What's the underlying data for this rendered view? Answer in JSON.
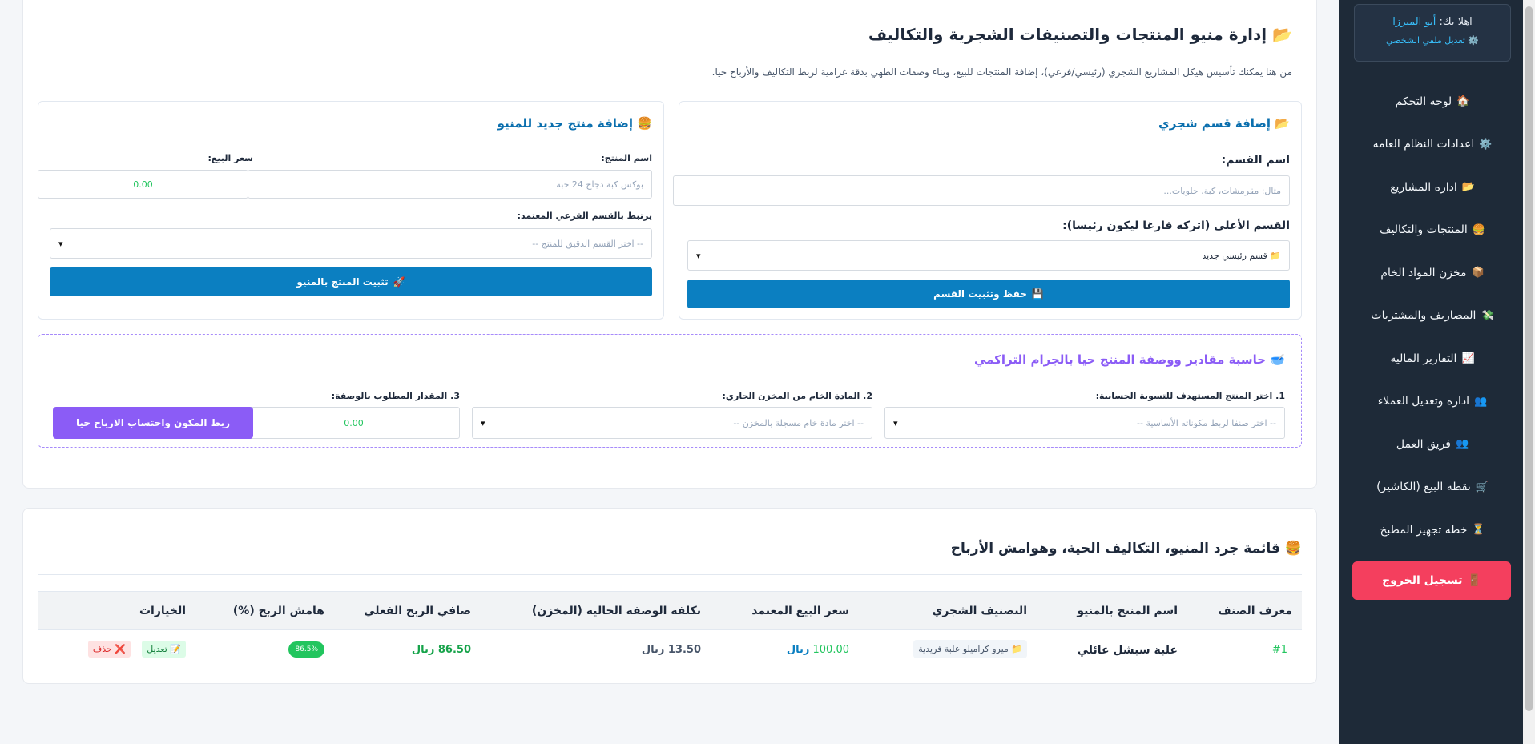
{
  "sidebar": {
    "greeting": "اهلا بك:",
    "user_name": "أبو الميرزا",
    "edit_profile": "تعديل ملفي الشخصي",
    "items": [
      {
        "icon": "🏠",
        "label": "لوحه التحكم"
      },
      {
        "icon": "⚙️",
        "label": "اعدادات النظام العامه"
      },
      {
        "icon": "📂",
        "label": "اداره المشاريع"
      },
      {
        "icon": "🍔",
        "label": "المنتجات والتكاليف"
      },
      {
        "icon": "📦",
        "label": "مخزن المواد الخام"
      },
      {
        "icon": "💸",
        "label": "المصاريف والمشتريات"
      },
      {
        "icon": "📈",
        "label": "التقارير الماليه"
      },
      {
        "icon": "👥",
        "label": "اداره وتعديل العملاء"
      },
      {
        "icon": "👥",
        "label": "فريق العمل"
      },
      {
        "icon": "🛒",
        "label": "نقطه البيع (الكاشير)"
      },
      {
        "icon": "⏳",
        "label": "خطه تجهيز المطبخ"
      }
    ],
    "logout": "تسجيل الخروج"
  },
  "header": {
    "title": "إدارة منيو المنتجات والتصنيفات الشجرية والتكاليف",
    "description": "من هنا يمكنك تأسيس هيكل المشاريع الشجري (رئيسي/فرعي)، إضافة المنتجات للبيع، وبناء وصفات الطهي بدقة غرامية لربط التكاليف والأرباح حيا."
  },
  "category_form": {
    "title": "إضافة قسم شجري",
    "name_label": "اسم القسم:",
    "name_placeholder": "مثال: مقرمشات، كبة، حلويات...",
    "parent_label": "القسم الأعلى (اتركه فارغا ليكون رئيسا):",
    "parent_value": "📁 قسم رئيسي جديد",
    "submit": "حفظ وتثبيت القسم"
  },
  "product_form": {
    "title": "إضافة منتج جديد للمنيو",
    "name_label": "اسم المنتج:",
    "name_placeholder": "بوكس كبة دجاج 24 حبة",
    "price_label": "سعر البيع:",
    "price_placeholder": "0.00",
    "subcat_label": "يرتبط بالقسم الفرعي المعتمد:",
    "subcat_value": "-- اختر القسم الدقيق للمنتج --",
    "submit": "تثبيت المنتج بالمنيو"
  },
  "recipe_calc": {
    "title": "حاسبة مقادير ووصفة المنتج حيا بالجرام التراكمي",
    "step1_label": "1. اختر المنتج المستهدف للتسوية الحسابية:",
    "step1_value": "-- اختر صنفا لربط مكوناته الأساسية --",
    "step2_label": "2. المادة الخام من المخزن الجاري:",
    "step2_value": "-- اختر مادة خام مسجلة بالمخزن --",
    "step3_label": "3. المقدار المطلوب بالوصفة:",
    "step3_placeholder": "0.00",
    "submit": "ربط المكون واحتساب الارباح حيا"
  },
  "menu_table": {
    "title": "قائمة جرد المنيو، التكاليف الحية، وهوامش الأرباح",
    "headers": [
      "معرف الصنف",
      "اسم المنتج بالمنيو",
      "التصنيف الشجري",
      "سعر البيع المعتمد",
      "تكلفة الوصفة الحالية (المخزن)",
      "صافي الربح الفعلي",
      "هامش الربح (%)",
      "الخيارات"
    ],
    "rows": [
      {
        "id": "#1",
        "name": "علبة سبشل عائلي",
        "category": "📁 ميرو كراميلو علبة فريدية",
        "price": "100.00",
        "currency": "ريال",
        "cost": "13.50 ريال",
        "profit": "86.50 ريال",
        "margin": "86.5%",
        "edit": "تعديل",
        "delete": "حذف"
      }
    ]
  },
  "colors": {
    "sidebar_bg": "#1e2a38",
    "primary": "#0b7fc1",
    "purple": "#8b5cf6",
    "danger": "#f43f5e",
    "success": "#22c55e"
  }
}
